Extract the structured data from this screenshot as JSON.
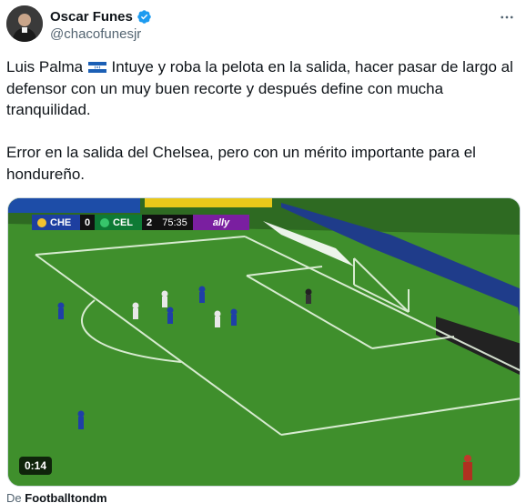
{
  "author": {
    "display_name": "Oscar Funes",
    "handle": "@chacofunesjr",
    "verified": true,
    "avatar_icon": "avatar-photo"
  },
  "menu_icon": "more-horizontal-icon",
  "tweet": {
    "text_part1": "Luis Palma ",
    "flag": "honduras-flag",
    "text_part2": " Intuye y roba la pelota en la salida, hacer pasar de largo al defensor con un muy buen recorte y después define con mucha tranquilidad.\n\nError en la salida del Chelsea, pero con un mérito importante para el hondureño."
  },
  "media": {
    "scoreboard": {
      "team1": "CHE",
      "score1": "0",
      "team2": "CEL",
      "score2": "2",
      "clock": "75:35",
      "sponsor": "ally"
    },
    "duration": "0:14",
    "colors": {
      "grass": "#3f8f2c",
      "che": "#1d3fa0",
      "cel": "#0e7a35",
      "sponsor": "#7a1fa0"
    }
  },
  "attribution": {
    "prefix": "De",
    "source": "Footballtondm"
  },
  "colors": {
    "verified_blue": "#1d9bf0",
    "text": "#0f1419",
    "secondary": "#536471"
  }
}
